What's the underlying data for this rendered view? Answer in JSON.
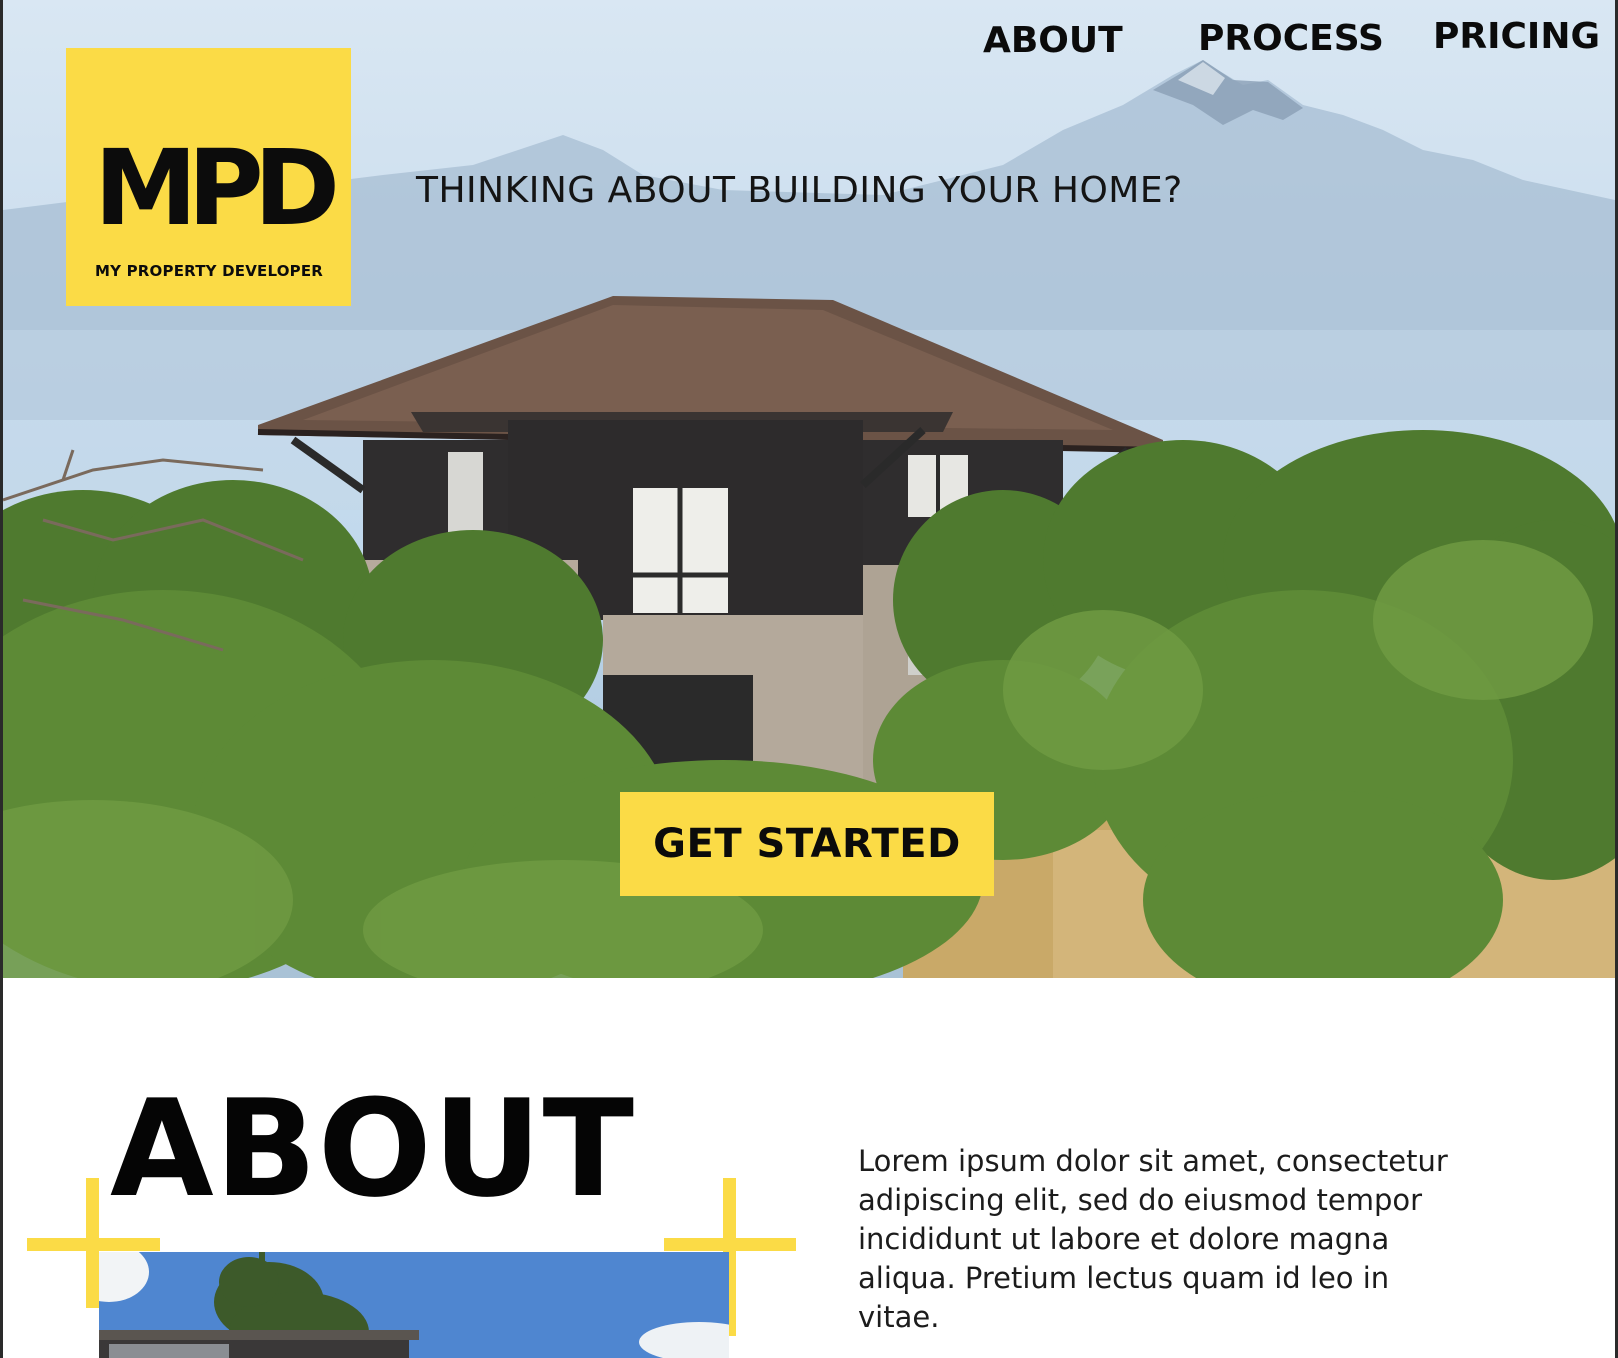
{
  "brand": {
    "logo_mark": "MPD",
    "logo_subtitle": "MY PROPERTY DEVELOPER"
  },
  "nav": {
    "items": [
      "ABOUT",
      "PROCESS",
      "PRICING"
    ]
  },
  "hero": {
    "tagline": "THINKING ABOUT BUILDING YOUR HOME?",
    "cta_label": "GET STARTED"
  },
  "about": {
    "heading": "ABOUT",
    "body": "Lorem ipsum dolor sit amet, consectetur adipiscing elit, sed do eiusmod tempor incididunt ut labore et dolore magna aliqua. Pretium lectus quam id leo in vitae."
  },
  "colors": {
    "accent": "#fbdb46",
    "text": "#0b0b0b",
    "background": "#ffffff"
  }
}
